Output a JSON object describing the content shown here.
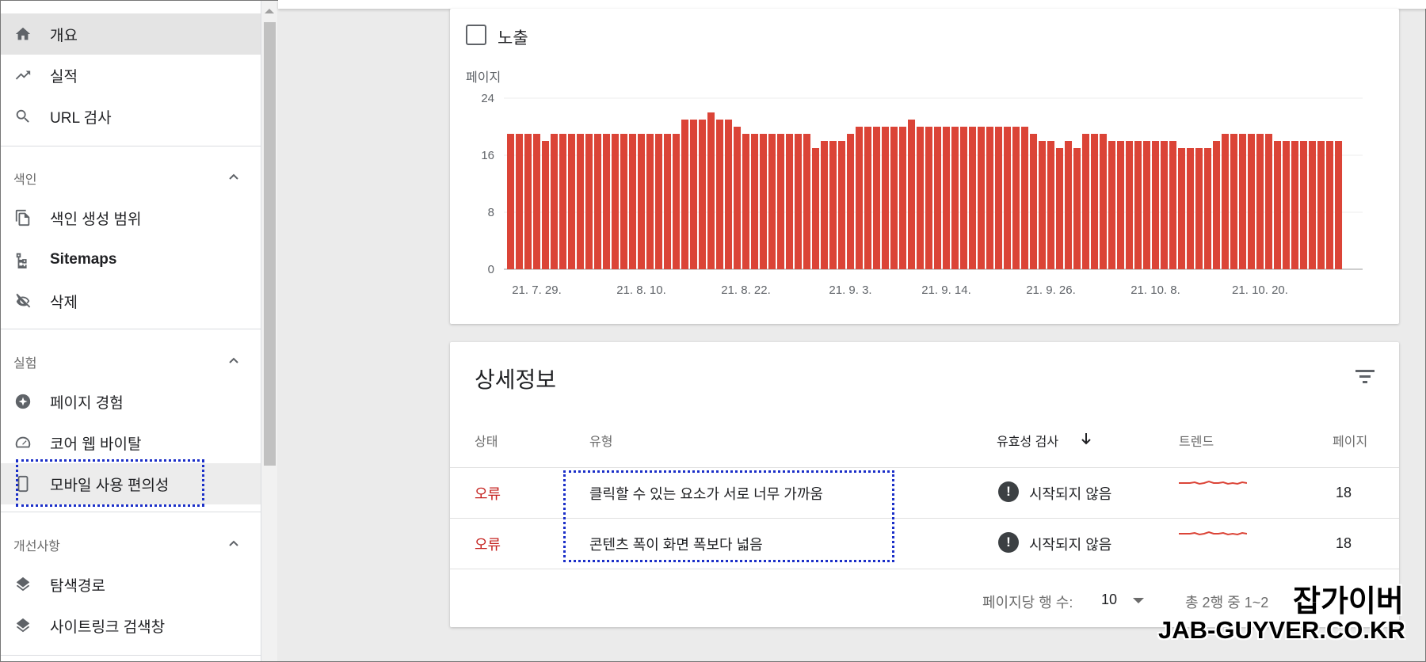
{
  "sidebar": {
    "items_top": [
      {
        "label": "개요",
        "icon": "home-icon"
      },
      {
        "label": "실적",
        "icon": "trending-up-icon"
      },
      {
        "label": "URL 검사",
        "icon": "search-icon"
      }
    ],
    "section_index": {
      "label": "색인"
    },
    "items_index": [
      {
        "label": "색인 생성 범위",
        "icon": "file-copy-icon"
      },
      {
        "label": "Sitemaps",
        "icon": "sitemap-icon"
      },
      {
        "label": "삭제",
        "icon": "eye-off-icon"
      }
    ],
    "section_exp": {
      "label": "실험"
    },
    "items_exp": [
      {
        "label": "페이지 경험",
        "icon": "plus-circle-icon"
      },
      {
        "label": "코어 웹 바이탈",
        "icon": "gauge-icon"
      },
      {
        "label": "모바일 사용 편의성",
        "icon": "phone-icon"
      }
    ],
    "section_improve": {
      "label": "개선사항"
    },
    "items_improve": [
      {
        "label": "탐색경로",
        "icon": "layers-icon"
      },
      {
        "label": "사이트링크 검색창",
        "icon": "layers-icon"
      }
    ]
  },
  "chart_card": {
    "checkbox_label": "노출"
  },
  "chart_data": {
    "type": "bar",
    "ylabel": "페이지",
    "ylim": [
      0,
      24
    ],
    "yticks": [
      0,
      8,
      16,
      24
    ],
    "xtick_labels": [
      "21. 7. 29.",
      "21. 8. 10.",
      "21. 8. 22.",
      "21. 9. 3.",
      "21. 9. 14.",
      "21. 9. 26.",
      "21. 10. 8.",
      "21. 10. 20."
    ],
    "xtick_bar_index": [
      3,
      15,
      27,
      39,
      50,
      62,
      74,
      86
    ],
    "values": [
      19,
      19,
      19,
      19,
      18,
      19,
      19,
      19,
      19,
      19,
      19,
      19,
      19,
      19,
      19,
      19,
      19,
      19,
      19,
      19,
      21,
      21,
      21,
      22,
      21,
      21,
      20,
      19,
      19,
      19,
      19,
      19,
      19,
      19,
      19,
      17,
      18,
      18,
      18,
      19,
      20,
      20,
      20,
      20,
      20,
      20,
      21,
      20,
      20,
      20,
      20,
      20,
      20,
      20,
      20,
      20,
      20,
      20,
      20,
      20,
      19,
      18,
      18,
      17,
      18,
      17,
      19,
      19,
      19,
      18,
      18,
      18,
      18,
      18,
      18,
      18,
      18,
      17,
      17,
      17,
      17,
      18,
      19,
      19,
      19,
      19,
      19,
      19,
      18,
      18,
      18,
      18,
      18,
      18,
      18,
      18
    ],
    "bar_color": "#db4437",
    "grid": true
  },
  "details": {
    "title": "상세정보",
    "headers": {
      "status": "상태",
      "type": "유형",
      "validation": "유효성 검사",
      "trend": "트렌드",
      "pages": "페이지"
    },
    "rows": [
      {
        "status": "오류",
        "type": "클릭할 수 있는 요소가 서로 너무 가까움",
        "validation": "시작되지 않음",
        "pages": "18"
      },
      {
        "status": "오류",
        "type": "콘텐츠 폭이 화면 폭보다 넓음",
        "validation": "시작되지 않음",
        "pages": "18"
      }
    ],
    "footer": {
      "rows_per_page_label": "페이지당 행 수:",
      "rows_per_page_value": "10",
      "range": "총 2행 중 1~2"
    }
  },
  "watermark": {
    "ko": "잡가이버",
    "en": "JAB-GUYVER.CO.KR"
  },
  "colors": {
    "accent_red": "#db4437",
    "error_text": "#c5221f",
    "highlight_dotted": "#1a2ec8"
  }
}
